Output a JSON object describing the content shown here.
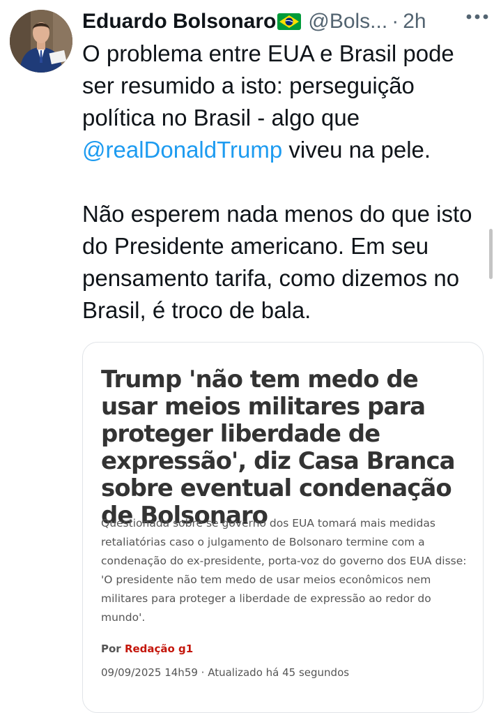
{
  "tweet": {
    "author_name": "Eduardo Bolsonaro",
    "author_flag": "brazil-flag-icon",
    "handle": "@Bols...",
    "separator": "·",
    "time": "2h",
    "paragraph1_before": "O problema entre EUA e Brasil pode ser resumido a isto: perseguição política no Brasil - algo que ",
    "mention": "@realDonaldTrump",
    "paragraph1_after": " viveu na pele.",
    "paragraph2": "Não esperem nada menos do que isto do Presidente americano. Em seu pensamento tarifa, como dizemos no Brasil, é troco de bala."
  },
  "card": {
    "headline": "Trump 'não tem medo de usar meios militares para proteger liberdade de expressão', diz Casa Branca sobre eventual condenação de Bolsonaro",
    "summary": "Questionada sobre se governo dos EUA tomará mais medidas retaliatórias caso o julgamento de Bolsonaro termine com a condenação do ex-presidente, porta-voz do governo dos EUA disse: 'O presidente não tem medo de usar meios econômicos nem militares para proteger a liberdade de expressão ao redor do mundo'.",
    "byline_prefix": "Por",
    "byline_author": "Redação g1",
    "dateline": "09/09/2025 14h59 · Atualizado há 45 segundos"
  },
  "colors": {
    "mention": "#1d9bf0",
    "author_red": "#c4170c",
    "secondary_text": "#536471"
  }
}
